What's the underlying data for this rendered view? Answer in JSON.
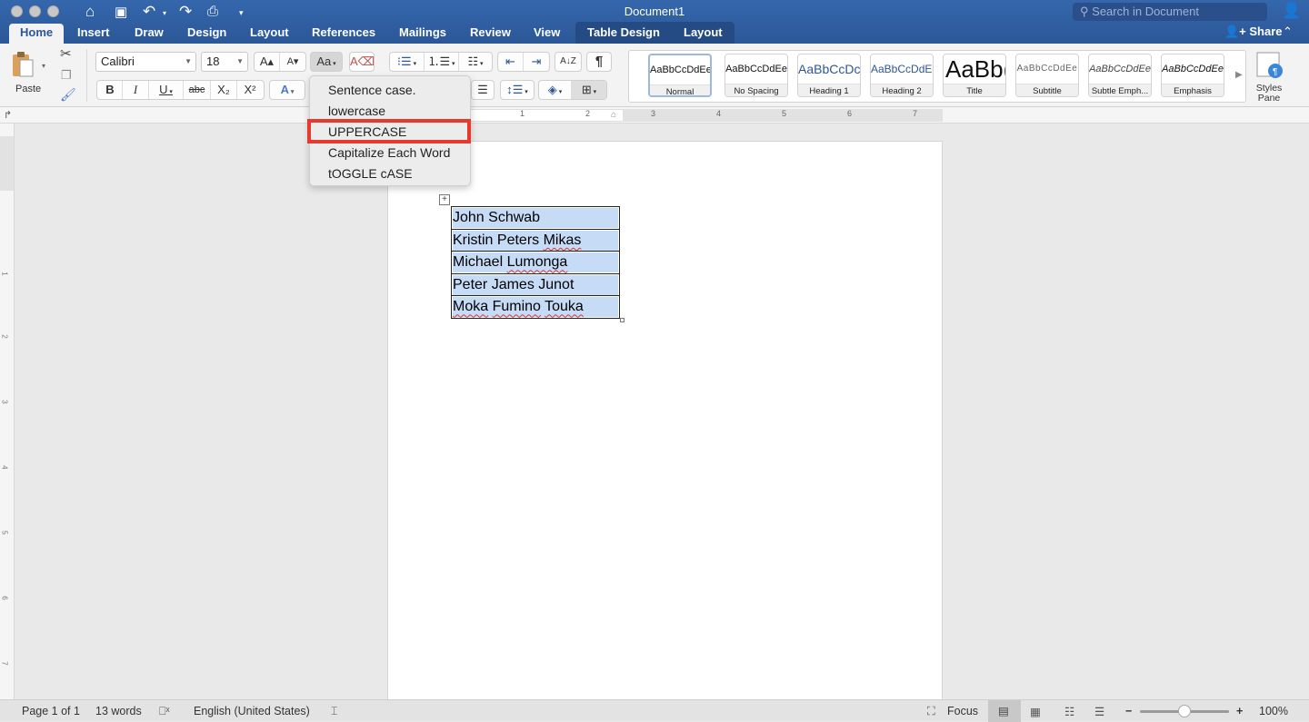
{
  "window": {
    "title": "Document1",
    "search_placeholder": "Search in Document",
    "share_label": "Share"
  },
  "tabs": [
    {
      "label": "Home",
      "active": true
    },
    {
      "label": "Insert"
    },
    {
      "label": "Draw"
    },
    {
      "label": "Design"
    },
    {
      "label": "Layout"
    },
    {
      "label": "References"
    },
    {
      "label": "Mailings"
    },
    {
      "label": "Review"
    },
    {
      "label": "View"
    },
    {
      "label": "Table Design",
      "contextual": true
    },
    {
      "label": "Layout",
      "contextual": true
    }
  ],
  "ribbon": {
    "paste_label": "Paste",
    "font_name": "Calibri",
    "font_size": "18",
    "grow_font": "A▴",
    "shrink_font": "A▾",
    "change_case": "Aa",
    "bold": "B",
    "italic": "I",
    "underline": "U",
    "strikethrough": "abc",
    "subscript": "X₂",
    "superscript": "X²",
    "text_effects": "A",
    "sort": "A↓Z",
    "show_marks": "¶",
    "styles": [
      {
        "preview": "AaBbCcDdEe",
        "name": "Normal",
        "selected": true
      },
      {
        "preview": "AaBbCcDdEe",
        "name": "No Spacing"
      },
      {
        "preview": "AaBbCcDc",
        "name": "Heading 1"
      },
      {
        "preview": "AaBbCcDdEe",
        "name": "Heading 2"
      },
      {
        "preview": "AaBb(",
        "name": "Title"
      },
      {
        "preview": "AaBbCcDdEe",
        "name": "Subtitle"
      },
      {
        "preview": "AaBbCcDdEe",
        "name": "Subtle Emph..."
      },
      {
        "preview": "AaBbCcDdEe",
        "name": "Emphasis"
      }
    ],
    "styles_pane_label_1": "Styles",
    "styles_pane_label_2": "Pane"
  },
  "change_case_menu": {
    "items": [
      {
        "label": "Sentence case."
      },
      {
        "label": "lowercase"
      },
      {
        "label": "UPPERCASE",
        "highlighted": true
      },
      {
        "label": "Capitalize Each Word"
      },
      {
        "label": "tOGGLE cASE"
      }
    ],
    "highlight_color": "#e8392f"
  },
  "ruler": {
    "horizontal_numbers": [
      "1",
      "2",
      "3",
      "4",
      "5",
      "6",
      "7"
    ],
    "vertical_numbers": [
      "1",
      "2",
      "3",
      "4",
      "5",
      "6",
      "7"
    ]
  },
  "document": {
    "table_rows": [
      {
        "text": "John Schwab"
      },
      {
        "text": "Kristin Peters Mikas"
      },
      {
        "text": "Michael Lumonga"
      },
      {
        "text": "Peter James Junot"
      },
      {
        "text": "Moka Fumino Touka"
      }
    ],
    "selection_color": "#c6dbf6"
  },
  "statusbar": {
    "page": "Page 1 of 1",
    "words": "13 words",
    "language": "English (United States)",
    "focus": "Focus",
    "zoom": "100%",
    "zoom_minus": "−",
    "zoom_plus": "+",
    "zoom_fraction": 0.5
  },
  "colors": {
    "titlebar": "#2b5797",
    "accent": "#2b5797"
  }
}
